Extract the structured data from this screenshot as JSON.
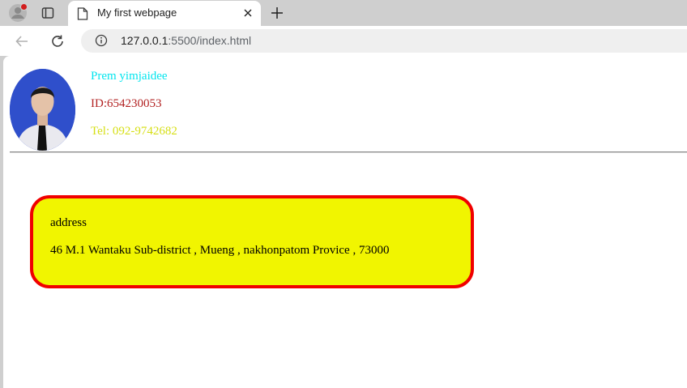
{
  "browser": {
    "tab": {
      "title": "My first webpage"
    },
    "address_bar": {
      "url_host": "127.0.0.1",
      "url_rest": ":5500/index.html"
    }
  },
  "profile": {
    "name": "Prem yimjaidee",
    "id": "ID:654230053",
    "tel": "Tel: 092-9742682"
  },
  "address": {
    "label": "address",
    "text": "46 M.1 Wantaku Sub-district , Mueng , nakhonpatom Provice , 73000"
  },
  "colors": {
    "name": "#00e5ee",
    "id": "#b22222",
    "tel": "#d6df14",
    "box_fill": "#f1f500",
    "box_border": "#f00000"
  },
  "icons": [
    "profile-icon",
    "tab-actions-icon",
    "page-favicon-icon",
    "close-icon",
    "new-tab-icon",
    "back-arrow-icon",
    "reload-icon",
    "site-info-icon"
  ]
}
